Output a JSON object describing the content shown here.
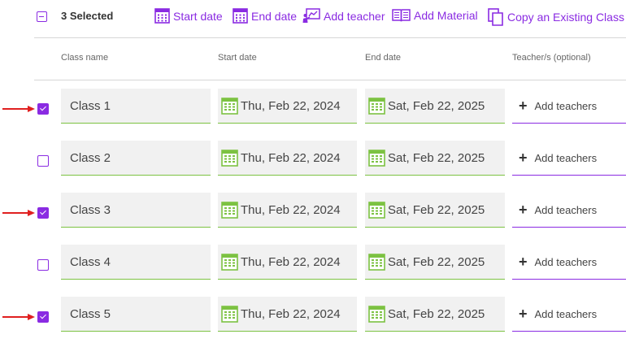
{
  "toolbar": {
    "selected_label": "3 Selected",
    "start_date_label": "Start date",
    "end_date_label": "End date",
    "add_teacher_label": "Add teacher",
    "add_material_label": "Add Material",
    "copy_class_label": "Copy an Existing Class"
  },
  "columns": {
    "class_name": "Class name",
    "start_date": "Start date",
    "end_date": "End date",
    "teachers": "Teacher/s (optional)"
  },
  "rows": [
    {
      "checked": true,
      "name": "Class 1",
      "start": "Thu, Feb 22, 2024",
      "end": "Sat, Feb 22, 2025",
      "teachers_label": "Add teachers"
    },
    {
      "checked": false,
      "name": "Class 2",
      "start": "Thu, Feb 22, 2024",
      "end": "Sat, Feb 22, 2025",
      "teachers_label": "Add teachers"
    },
    {
      "checked": true,
      "name": "Class 3",
      "start": "Thu, Feb 22, 2024",
      "end": "Sat, Feb 22, 2025",
      "teachers_label": "Add teachers"
    },
    {
      "checked": false,
      "name": "Class 4",
      "start": "Thu, Feb 22, 2024",
      "end": "Sat, Feb 22, 2025",
      "teachers_label": "Add teachers"
    },
    {
      "checked": true,
      "name": "Class 5",
      "start": "Thu, Feb 22, 2024",
      "end": "Sat, Feb 22, 2025",
      "teachers_label": "Add teachers"
    }
  ],
  "colors": {
    "accent": "#8a2be2",
    "date_green": "#7cc242",
    "arrow_red": "#e02020"
  }
}
